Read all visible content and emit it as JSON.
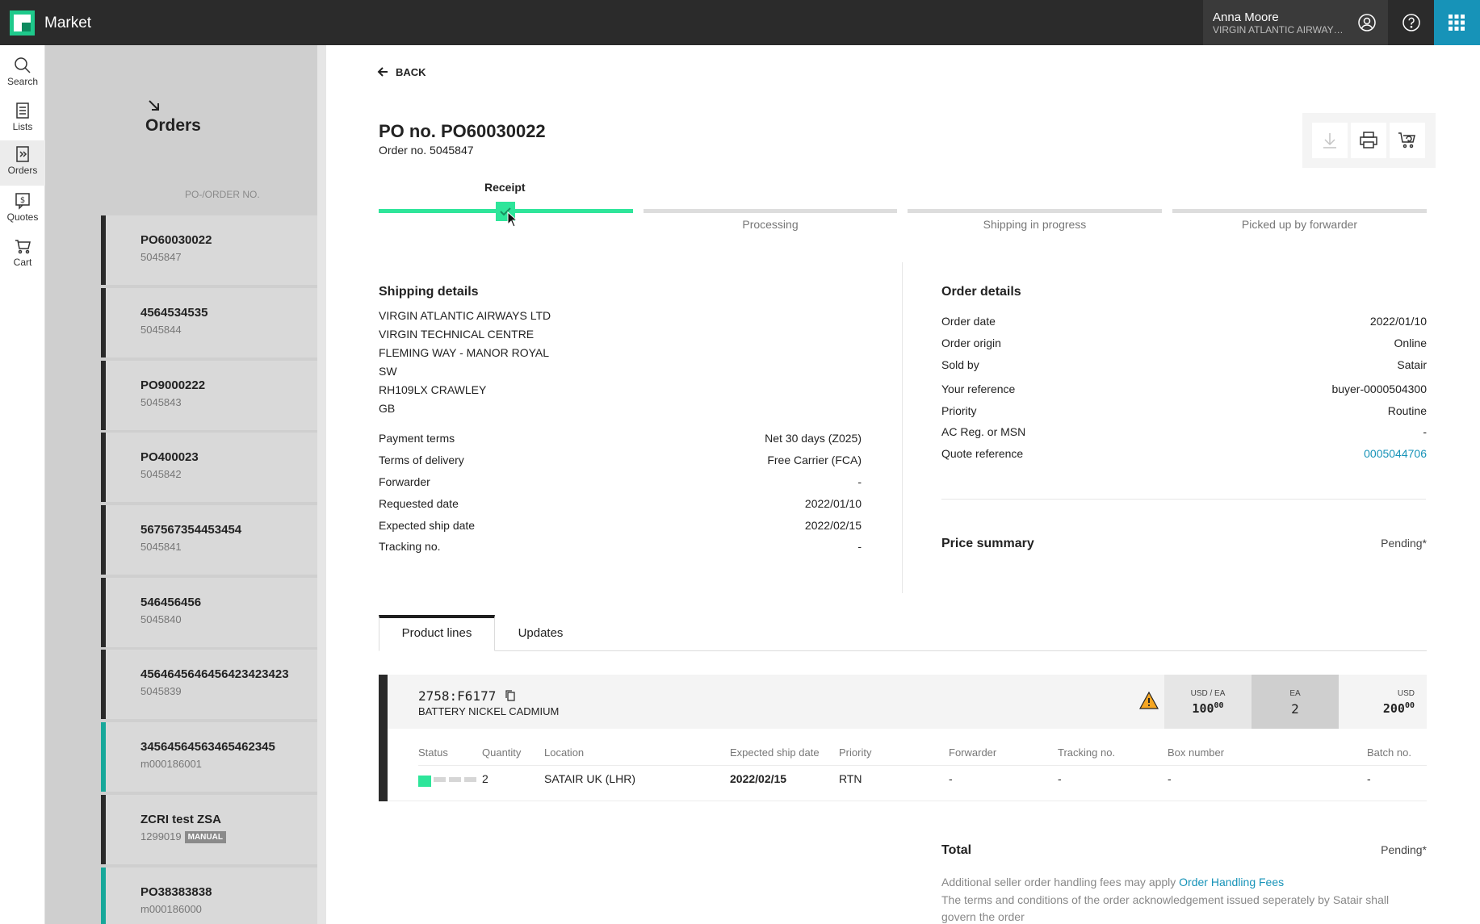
{
  "app": {
    "title": "Market"
  },
  "user": {
    "name": "Anna Moore",
    "org": "VIRGIN ATLANTIC AIRWAYS LTD"
  },
  "nav": [
    {
      "label": "Search",
      "icon": "search-icon"
    },
    {
      "label": "Lists",
      "icon": "list-icon"
    },
    {
      "label": "Orders",
      "icon": "orders-icon",
      "active": true
    },
    {
      "label": "Quotes",
      "icon": "quotes-icon"
    },
    {
      "label": "Cart",
      "icon": "cart-icon"
    }
  ],
  "orders": {
    "title": "Orders",
    "column_header": "PO-/ORDER NO.",
    "items": [
      {
        "po": "PO60030022",
        "no": "5045847"
      },
      {
        "po": "4564534535",
        "no": "5045844"
      },
      {
        "po": "PO9000222",
        "no": "5045843"
      },
      {
        "po": "PO400023",
        "no": "5045842"
      },
      {
        "po": "567567354453454",
        "no": "5045841"
      },
      {
        "po": "546456456",
        "no": "5045840"
      },
      {
        "po": "4564645646456423423423",
        "no": "5045839"
      },
      {
        "po": "34564564563465462345",
        "no": "m000186001"
      },
      {
        "po": "ZCRI test ZSA",
        "no": "1299019",
        "badge": "MANUAL"
      },
      {
        "po": "PO38383838",
        "no": "m000186000"
      }
    ]
  },
  "detail": {
    "back_label": "BACK",
    "po_title": "PO no. PO60030022",
    "order_subtitle": "Order no. 5045847",
    "progress": {
      "current": "Receipt",
      "steps": [
        "Receipt",
        "Processing",
        "Shipping in progress",
        "Picked up by forwarder"
      ],
      "completed_steps": 1
    },
    "shipping": {
      "title": "Shipping details",
      "address": [
        "VIRGIN ATLANTIC AIRWAYS LTD",
        "VIRGIN TECHNICAL CENTRE",
        "FLEMING WAY - MANOR ROYAL",
        "SW",
        "RH109LX CRAWLEY",
        "GB"
      ],
      "fields": [
        {
          "label": "Payment terms",
          "value": "Net 30 days (Z025)"
        },
        {
          "label": "Terms of delivery",
          "value": "Free Carrier (FCA)"
        },
        {
          "label": "Forwarder",
          "value": "-"
        },
        {
          "label": "Requested date",
          "value": "2022/01/10"
        },
        {
          "label": "Expected ship date",
          "value": "2022/02/15"
        },
        {
          "label": "Tracking no.",
          "value": "-"
        }
      ]
    },
    "order_details": {
      "title": "Order details",
      "fields": [
        {
          "label": "Order date",
          "value": "2022/01/10"
        },
        {
          "label": "Order origin",
          "value": "Online"
        },
        {
          "label": "Sold by",
          "value": "Satair"
        },
        {
          "label": "Your reference",
          "value": "buyer-0000504300"
        },
        {
          "label": "Priority",
          "value": "Routine"
        },
        {
          "label": "AC Reg. or MSN",
          "value": "-"
        },
        {
          "label": "Quote reference",
          "value": "0005044706"
        }
      ]
    },
    "price_summary": {
      "title": "Price summary",
      "value": "Pending*"
    },
    "tabs": [
      "Product lines",
      "Updates"
    ],
    "product_line": {
      "part_no": "2758:F6177",
      "description": "BATTERY NICKEL CADMIUM",
      "unit_caption": "USD / EA",
      "unit_price": "100",
      "unit_price_dec": "00",
      "qty_caption": "EA",
      "qty": "2",
      "total_caption": "USD",
      "total_price": "200",
      "total_price_dec": "00",
      "columns": [
        "Status",
        "Quantity",
        "Location",
        "Expected ship date",
        "Priority",
        "Forwarder",
        "Tracking no.",
        "Box number",
        "Batch no."
      ],
      "row": {
        "quantity": "2",
        "location": "SATAIR UK (LHR)",
        "expected_ship_date": "2022/02/15",
        "priority": "RTN",
        "forwarder": "-",
        "tracking": "-",
        "box": "-",
        "batch": "-"
      }
    },
    "total": {
      "title": "Total",
      "value": "Pending*"
    },
    "footer": {
      "fees_text": "Additional seller order handling fees may apply",
      "fees_link": "Order Handling Fees",
      "terms_line1": "The terms and conditions of the order acknowledgement issued seperately by Satair shall",
      "terms_line2": "govern the order"
    }
  },
  "colors": {
    "accent_green": "#2ee59a",
    "teal": "#17a89a",
    "link": "#1793b8",
    "topbar": "#2b2b2b"
  }
}
